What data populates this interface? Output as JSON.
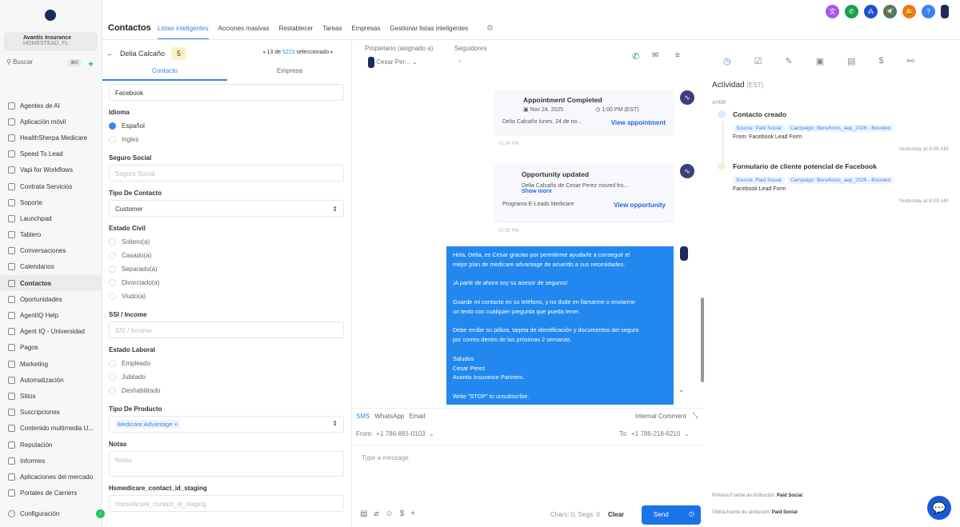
{
  "sidebar": {
    "account_name": "Avantis Insurance",
    "account_location": "HOMESTEAD, FL",
    "search": "Buscar",
    "shortcut": "⌘K",
    "items": [
      "Agentes de AI",
      "Aplicación móvil",
      "HealthSherpa Medicare",
      "Speed To Lead",
      "Vapi for Workflows",
      "Contrata Servicios",
      "Soporte",
      "Launchpad",
      "Tablero",
      "Conversaciones",
      "Calendarios",
      "Contactos",
      "Oportunidades",
      "AgentIQ Help",
      "Agent IQ - Universidad",
      "Pagos",
      "Marketing",
      "Automatización",
      "Sitios",
      "Suscripciones",
      "Contenido multimedia U...",
      "Reputación",
      "Informes",
      "Aplicaciones del mercado",
      "Portales de Carriers"
    ],
    "settings": "Configuración",
    "active": "Contactos"
  },
  "header": {
    "title": "Contactos",
    "tabs": [
      "Listas inteligentes",
      "Acciones masivas",
      "Restablecer",
      "Tareas",
      "Empresas",
      "Gestionar listas inteligentes"
    ]
  },
  "contact": {
    "name": "Delia Calcaño",
    "badge": "5",
    "pager_index": "13 de",
    "pager_total": "5223",
    "pager_suffix": "seleccionado",
    "tabs": [
      "Contacto",
      "Empresa"
    ]
  },
  "form": {
    "source_value": "Facebook",
    "idioma_label": "Idioma",
    "idioma": [
      "Español",
      "Ingles"
    ],
    "seguro_label": "Seguro Social",
    "seguro_ph": "Seguro Social",
    "tipo_contacto_label": "Tipo De Contacto",
    "tipo_contacto": "Customer",
    "estado_civil_label": "Estado Civil",
    "estado_civil": [
      "Soltero(a)",
      "Casado(a)",
      "Separado(a)",
      "Divorciado(a)",
      "Viudo(a)"
    ],
    "ssi_label": "SSI / Income",
    "ssi_ph": "SSI / Income",
    "laboral_label": "Estado Laboral",
    "laboral": [
      "Empleado",
      "Jubilado",
      "Deshabilitado"
    ],
    "producto_label": "Tipo De Producto",
    "producto": "Medicare Advantage",
    "notas_label": "Notas",
    "notas_ph": "Notas",
    "hs_label": "Hsmedicare_contact_id_staging",
    "hs_ph": "Hsmedicare_contact_id_staging"
  },
  "conversation": {
    "owner_label": "Propietario (asignado a)",
    "owner": "Cesar Per...",
    "followers_label": "Seguidores",
    "appt": {
      "title": "Appointment Completed",
      "date": "Nov 24, 2025",
      "time": "1:00 PM (EST)",
      "desc": "Delia Calcaño lunes, 24 de no...",
      "link": "View appointment",
      "stamp": "01:34 PM"
    },
    "opp": {
      "title": "Opportunity updated",
      "desc": "Delia Calcaño de Cesar Perez moved fro...",
      "more": "Show more",
      "pipeline": "Programa E-Leads Medicare",
      "link": "View opportunity",
      "stamp": "01:35 PM"
    },
    "message": "Hola, Delia, es Cesar  gracias por permitirme ayudarle a conseguir el\nmejor plan de medicare advantage de acuerdo a sus necesidades.\n\n¡A partir de ahora soy su asesor de seguros!\n\nGuarde mi contacto en su teléfono, y no dude en llamarme o enviarme\nun texto con cualquier pregunta que pueda tener.\n\nDebe recibir su póliza, tarjeta de identificación y documentos del seguro\npor correo dentro de las próximas 2 semanas.\n\nSaludos\nCesar  Perez\nAvantis Insurance Partners.\n\nWrite \"STOP\" to unsubscribe."
  },
  "composer": {
    "tabs": [
      "SMS",
      "WhatsApp",
      "Email"
    ],
    "internal": "Internal Comment",
    "from_label": "From:",
    "from": "+1 786-891-0103",
    "to_label": "To:",
    "to": "+1 786-218-6210",
    "placeholder": "Type a message",
    "counter": "Chars: 0, Segs: 0",
    "clear": "Clear",
    "send": "Send"
  },
  "activity": {
    "title": "Actividad",
    "tz": "(EST)",
    "day": "AYER",
    "entries": [
      {
        "title": "Contacto creado",
        "source": "Source: Paid Social",
        "campaign": "Campaign: Beneficios_aep_2026 - Boosted",
        "detail": "From: Facebook Lead Form",
        "time": "Yesterday at 8:09 AM"
      },
      {
        "title": "Formulario de cliente potencial de Facebook",
        "source": "Source: Paid Social",
        "campaign": "Campaign: Beneficios_aep_2026 - Boosted",
        "detail": "Facebook Lead Form",
        "time": "Yesterday at 8:09 AM"
      }
    ],
    "first_label": "Primera Fuente de Atribución:",
    "first": "Paid Social",
    "last_label": "Última fuente de atribución:",
    "last": "Paid Social"
  },
  "colors": {
    "accent": "#3b82f6",
    "bubble": "#2288f0",
    "send": "#1a73e8"
  }
}
